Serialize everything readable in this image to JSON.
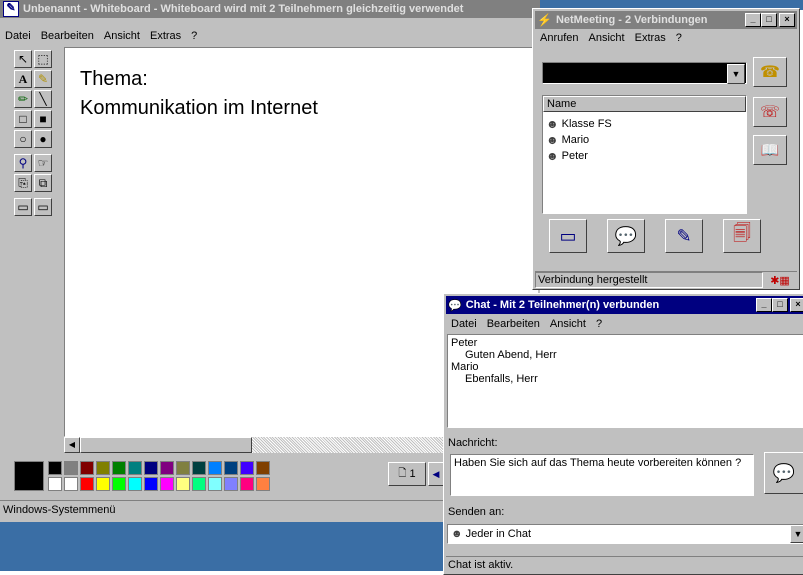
{
  "whiteboard": {
    "title": "Unbenannt - Whiteboard - Whiteboard wird mit 2 Teilnehmern gleichzeitig verwendet",
    "menu": [
      "Datei",
      "Bearbeiten",
      "Ansicht",
      "Extras",
      "?"
    ],
    "canvas_line1": "Thema:",
    "canvas_line2": "Kommunikation im Internet",
    "page_label": "1",
    "status": "Windows-Systemmenü",
    "palette_row1": [
      "#808080",
      "#800000",
      "#808000",
      "#008000",
      "#008080",
      "#000080",
      "#800080",
      "#808040",
      "#004040",
      "#0080ff",
      "#004080",
      "#4000ff",
      "#804000"
    ],
    "palette_row2": [
      "#ffffff",
      "#ff0000",
      "#ffff00",
      "#00ff00",
      "#00ffff",
      "#0000ff",
      "#ff00ff",
      "#ffff80",
      "#00ff80",
      "#80ffff",
      "#8080ff",
      "#ff0080",
      "#ff8040"
    ]
  },
  "netmeeting": {
    "title": "NetMeeting - 2 Verbindungen",
    "menu": [
      "Anrufen",
      "Ansicht",
      "Extras",
      "?"
    ],
    "list_header": "Name",
    "participants": [
      "Klasse FS",
      "Mario",
      "Peter"
    ],
    "status": "Verbindung hergestellt"
  },
  "chat": {
    "title": "Chat - Mit 2 Teilnehmer(n) verbunden",
    "menu": [
      "Datei",
      "Bearbeiten",
      "Ansicht",
      "?"
    ],
    "messages": [
      {
        "sender": "Peter",
        "text": "Guten Abend, Herr"
      },
      {
        "sender": "Mario",
        "text": "Ebenfalls, Herr"
      }
    ],
    "message_label": "Nachricht:",
    "message_value": "Haben Sie sich auf das Thema heute vorbereiten können ?",
    "send_to_label": "Senden an:",
    "send_to_value": "Jeder in Chat",
    "status": "Chat ist aktiv."
  }
}
